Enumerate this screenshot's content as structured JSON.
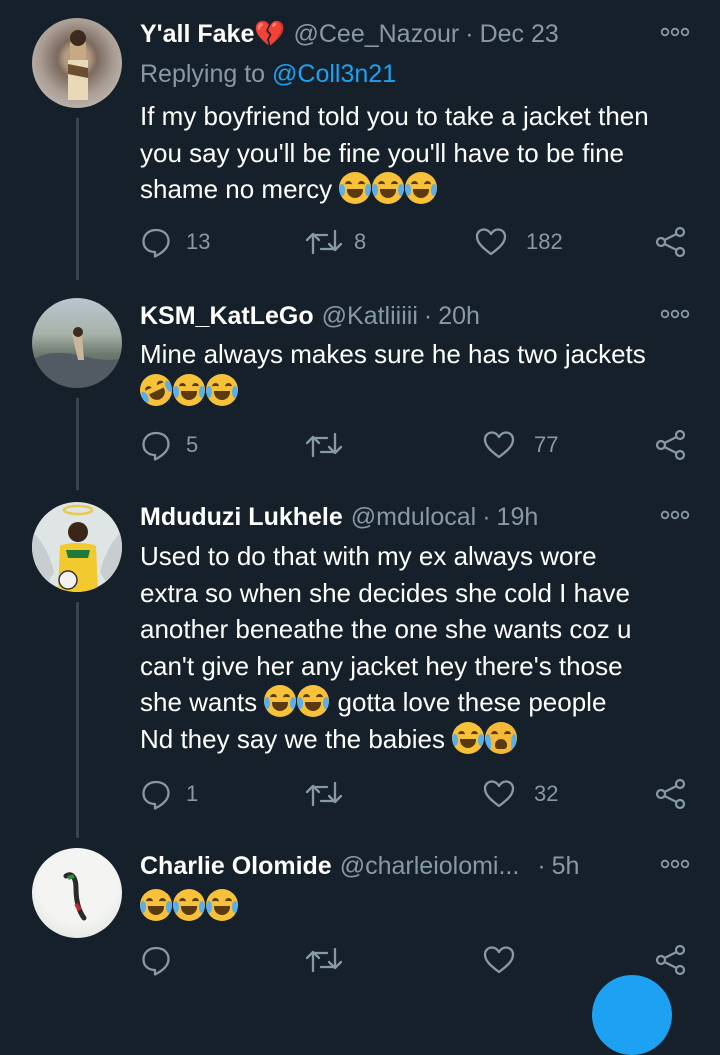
{
  "tweets": [
    {
      "name": "Y'all Fake💔",
      "handle": "@Cee_Nazour",
      "sep": "·",
      "time": "Dec 23",
      "replying_prefix": "Replying to ",
      "replying_to": "@Coll3n21",
      "text_lines": [
        "If my boyfriend told you to take a jacket then",
        "you say you'll be fine you'll have to be fine",
        "shame no mercy"
      ],
      "emojis": [
        "joy-emoji",
        "joy-emoji",
        "joy-emoji"
      ],
      "replies": "13",
      "retweets": "8",
      "likes": "182"
    },
    {
      "name": "KSM_KatLeGo",
      "handle": "@Katliiiii",
      "sep": "·",
      "time": "20h",
      "text_lines": [
        "Mine always makes sure he has two jackets"
      ],
      "emojis": [
        "rofl-emoji",
        "joy-emoji",
        "joy-emoji"
      ],
      "replies": "5",
      "retweets": "",
      "likes": "77"
    },
    {
      "name": "Mduduzi Lukhele",
      "handle": "@mdulocal",
      "sep": "·",
      "time": "19h",
      "text_lines": [
        "Used to do that with my ex always wore",
        "extra so when she decides she cold I have",
        "another beneathe the one she wants coz u",
        "can't give her any jacket hey there's those",
        "she wants",
        "gotta love these people",
        "Nd they say we the babies"
      ],
      "emojis": [
        "joy-emoji",
        "joy-emoji",
        "joy-emoji",
        "sob-emoji"
      ],
      "replies": "1",
      "retweets": "",
      "likes": "32"
    },
    {
      "name": "Charlie Olomide",
      "handle": "@charleiolomi...",
      "sep": "·",
      "time": "5h",
      "text_lines": [],
      "emojis": [
        "joy-emoji",
        "joy-emoji",
        "joy-emoji"
      ],
      "replies": "",
      "retweets": "",
      "likes": ""
    }
  ],
  "colors": {
    "background": "#15202b",
    "secondary_text": "#8899a6",
    "link": "#1da1f2",
    "thread_line": "#38444d"
  }
}
